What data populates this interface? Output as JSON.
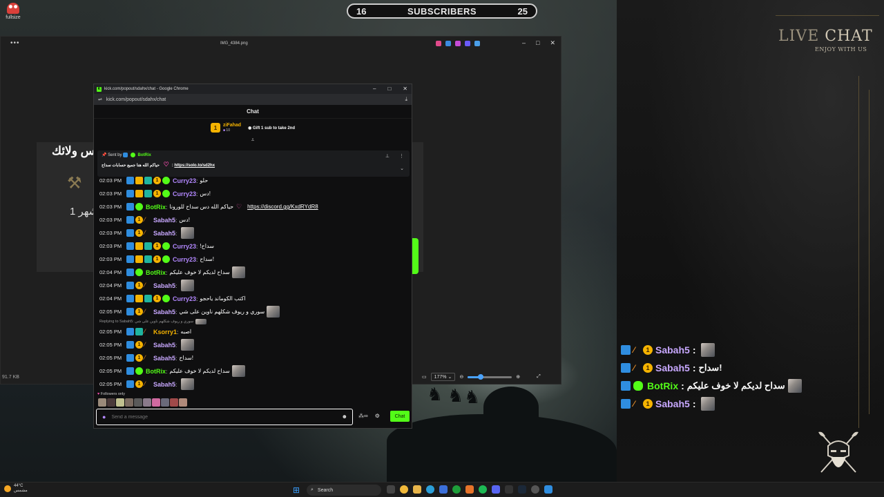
{
  "desktop": {
    "icon_label": "fullsize"
  },
  "subscribers": {
    "current": "16",
    "label": "SUBSCRIBERS",
    "goal": "25"
  },
  "viewer": {
    "filename": "IMG_4384.png",
    "bg_title": "س ولائك",
    "bg_month": "شهر 1",
    "file_size": "91.7 KB",
    "zoom": "177%",
    "zoom_slider_fraction": 0.3
  },
  "chrome": {
    "window_title": "kick.com/popout/sdahx/chat - Google Chrome",
    "address": "kick.com/popout/sdahx/chat",
    "chat_header": "Chat",
    "gift": {
      "rank": "1",
      "name": "ziFahad",
      "count": "10",
      "message": "Gift 1 sub to take 2nd"
    },
    "pinned": {
      "sent_by_label": "Sent by",
      "sender": "BotRix",
      "text": "حياكم الله هنا جميع حسابات سداح",
      "link": "https://solo.to/sd2hx"
    },
    "messages": [
      {
        "time": "02:03 PM",
        "user": "Curry23",
        "color": "purple",
        "badges": [
          "arrow",
          "crown",
          "grid",
          "coin",
          "verified"
        ],
        "text": "حلو",
        "emote": false
      },
      {
        "time": "02:03 PM",
        "user": "Curry23",
        "color": "purple",
        "badges": [
          "arrow",
          "crown",
          "grid",
          "coin",
          "verified"
        ],
        "text": "دس!",
        "emote": false
      },
      {
        "time": "02:03 PM",
        "user": "BotRix",
        "color": "green",
        "badges": [
          "arrow",
          "verified"
        ],
        "text": "حياكم الله دس سداح للورونا",
        "heart": true,
        "link": "https://discord.gg/KxdRYdR8",
        "emote": false
      },
      {
        "time": "02:03 PM",
        "user": "Sabah5",
        "color": "lav",
        "badges": [
          "arrow",
          "coin",
          "tool"
        ],
        "text": "دس!",
        "emote": false
      },
      {
        "time": "02:03 PM",
        "user": "Sabah5",
        "color": "lav",
        "badges": [
          "arrow",
          "coin",
          "tool"
        ],
        "text": "",
        "emote": true
      },
      {
        "time": "02:03 PM",
        "user": "Curry23",
        "color": "purple",
        "badges": [
          "arrow",
          "crown",
          "grid",
          "coin",
          "verified"
        ],
        "text": "!سداح",
        "emote": false
      },
      {
        "time": "02:03 PM",
        "user": "Curry23",
        "color": "purple",
        "badges": [
          "arrow",
          "crown",
          "grid",
          "coin",
          "verified"
        ],
        "text": "سداح!",
        "emote": false
      },
      {
        "time": "02:04 PM",
        "user": "BotRix",
        "color": "green",
        "badges": [
          "arrow",
          "verified"
        ],
        "text": "سداح لديكم لا خوف عليكم",
        "emote": true
      },
      {
        "time": "02:04 PM",
        "user": "Sabah5",
        "color": "lav",
        "badges": [
          "arrow",
          "coin",
          "tool"
        ],
        "text": "",
        "emote": true
      },
      {
        "time": "02:04 PM",
        "user": "Curry23",
        "color": "purple",
        "badges": [
          "arrow",
          "crown",
          "grid",
          "coin",
          "verified"
        ],
        "text": "اكتب الكوماند ياحجو",
        "emote": false
      },
      {
        "time": "02:05 PM",
        "user": "Sabah5",
        "color": "lav",
        "badges": [
          "arrow",
          "coin",
          "tool"
        ],
        "text": "سوري و ريوف شكلهم ناوين على شي",
        "emote": true
      },
      {
        "time": "02:05 PM",
        "user": "Ksorry1",
        "color": "gold",
        "badges": [
          "arrow",
          "grid",
          "tool"
        ],
        "reply": "Replying to Sabah5: سوري و ريوف شكلهم ناوين على شي",
        "text": "اصبه",
        "emote": false
      },
      {
        "time": "02:05 PM",
        "user": "Sabah5",
        "color": "lav",
        "badges": [
          "arrow",
          "coin",
          "tool"
        ],
        "text": "",
        "emote": true
      },
      {
        "time": "02:05 PM",
        "user": "Sabah5",
        "color": "lav",
        "badges": [
          "arrow",
          "coin",
          "tool"
        ],
        "text": "سداح!",
        "emote": false
      },
      {
        "time": "02:05 PM",
        "user": "BotRix",
        "color": "green",
        "badges": [
          "arrow",
          "verified"
        ],
        "text": "سداح لديكم لا خوف عليكم",
        "emote": true
      },
      {
        "time": "02:05 PM",
        "user": "Sabah5",
        "color": "lav",
        "badges": [
          "arrow",
          "coin",
          "tool"
        ],
        "text": "",
        "emote": true
      }
    ],
    "followers_only": "Followers only",
    "input_placeholder": "Send a message",
    "send_label": "Chat"
  },
  "overlay": {
    "live_word": "LIVE",
    "chat_word": "CHAT",
    "subtitle": "ENJOY WITH US",
    "messages": [
      {
        "user": "Sabah5",
        "color": "lav",
        "badges": [
          "arrow",
          "tool",
          "coin"
        ],
        "text": "",
        "emote": true
      },
      {
        "user": "Sabah5",
        "color": "lav",
        "badges": [
          "arrow",
          "tool",
          "coin"
        ],
        "text": "سداح!",
        "emote": false
      },
      {
        "user": "BotRix",
        "color": "green",
        "badges": [
          "arrow",
          "verified"
        ],
        "text": "سداح لديكم لا خوف عليكم",
        "emote": true
      },
      {
        "user": "Sabah5",
        "color": "lav",
        "badges": [
          "arrow",
          "tool",
          "coin"
        ],
        "text": "",
        "emote": true
      }
    ]
  },
  "taskbar": {
    "temperature": "44°C",
    "weather_text": "مشمس",
    "search_label": "Search"
  },
  "colors": {
    "kick_green": "#53fc18",
    "gold": "#f5b301",
    "purple": "#b388ff"
  }
}
